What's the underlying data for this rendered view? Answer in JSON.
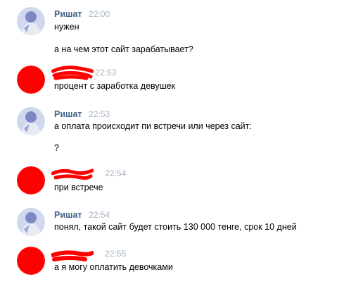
{
  "colors": {
    "author": "#42648b",
    "time": "#a8b3c1",
    "redaction": "#ff0000",
    "text": "#000000"
  },
  "messages": [
    {
      "author": "Ришат",
      "time": "22:00",
      "lines": [
        "нужен",
        "а на чем этот сайт зарабатывает?"
      ],
      "avatar": "user-photo-avatar",
      "redacted": false
    },
    {
      "author": "",
      "time": "22:53",
      "lines": [
        "процент с заработка девушек"
      ],
      "avatar": "redacted-avatar",
      "redacted": true
    },
    {
      "author": "Ришат",
      "time": "22:53",
      "lines": [
        "а оплата происходит пи встречи или через сайт:",
        "?"
      ],
      "avatar": "user-photo-avatar",
      "redacted": false
    },
    {
      "author": "",
      "time": "22:54",
      "lines": [
        "при встрече"
      ],
      "avatar": "redacted-avatar",
      "redacted": true
    },
    {
      "author": "Ришат",
      "time": "22:54",
      "lines": [
        "понял, такой сайт будет стоить 130 000 тенге, срок 10 дней"
      ],
      "avatar": "user-photo-avatar",
      "redacted": false
    },
    {
      "author": "",
      "time": "22:55",
      "lines": [
        "а я могу оплатить девочками"
      ],
      "avatar": "redacted-avatar",
      "redacted": true
    }
  ]
}
